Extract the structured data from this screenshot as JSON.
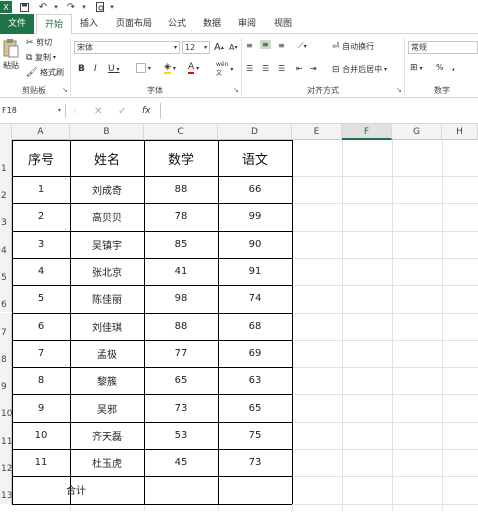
{
  "tabs": [
    "文件",
    "开始",
    "插入",
    "页面布局",
    "公式",
    "数据",
    "审阅",
    "视图"
  ],
  "ribbon": {
    "clipboard": {
      "paste": "粘贴",
      "cut": "剪切",
      "copy": "复制",
      "format_painter": "格式刷",
      "label": "剪贴板"
    },
    "font": {
      "name": "宋体",
      "size": "12",
      "bold": "B",
      "italic": "I",
      "underline": "U",
      "label": "字体",
      "grow": "A",
      "shrink": "A"
    },
    "alignment": {
      "wrap": "自动换行",
      "merge": "合并后居中",
      "label": "对齐方式"
    },
    "number": {
      "format": "常规",
      "label": "数字",
      "percent": "%",
      "comma": ","
    }
  },
  "formula_bar": {
    "name_box": "F18",
    "fx": "fx",
    "value": ""
  },
  "columns": [
    "A",
    "B",
    "C",
    "D",
    "E",
    "F",
    "G",
    "H"
  ],
  "selected_column": "F",
  "rows": [
    "1",
    "2",
    "3",
    "4",
    "5",
    "6",
    "7",
    "8",
    "9",
    "10",
    "11",
    "12",
    "13"
  ],
  "table": {
    "headers": [
      "序号",
      "姓名",
      "数学",
      "语文"
    ],
    "records": [
      [
        "1",
        "刘成奇",
        "88",
        "66"
      ],
      [
        "2",
        "高贝贝",
        "78",
        "99"
      ],
      [
        "3",
        "吴镇宇",
        "85",
        "90"
      ],
      [
        "4",
        "张北京",
        "41",
        "91"
      ],
      [
        "5",
        "陈佳丽",
        "98",
        "74"
      ],
      [
        "6",
        "刘佳琪",
        "88",
        "68"
      ],
      [
        "7",
        "孟极",
        "77",
        "69"
      ],
      [
        "8",
        "黎簇",
        "65",
        "63"
      ],
      [
        "9",
        "吴邪",
        "73",
        "65"
      ],
      [
        "10",
        "齐天磊",
        "53",
        "75"
      ],
      [
        "11",
        "杜玉虎",
        "45",
        "73"
      ]
    ],
    "total_label": "合计"
  }
}
